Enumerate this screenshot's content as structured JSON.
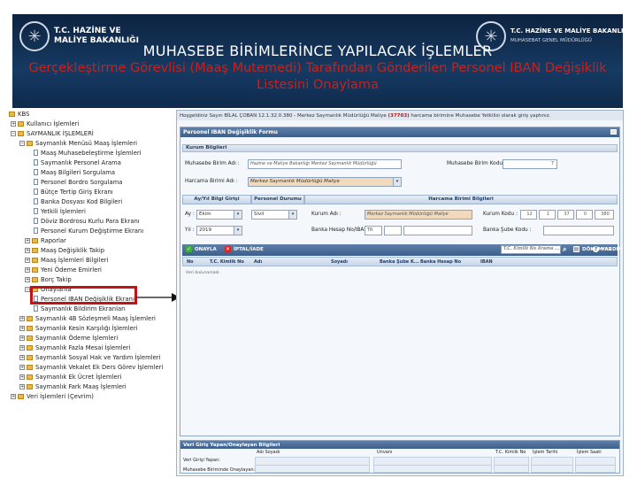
{
  "banner": {
    "logo_left_line1": "T.C. HAZİNE VE",
    "logo_left_line2": "MALİYE BAKANLIĞI",
    "logo_right_line1": "T.C. HAZİNE VE MALİYE BAKANLIĞI",
    "logo_right_line2": "MUHASEBAT GENEL MÜDÜRLÜĞÜ",
    "title": "MUHASEBE BİRİMLERİNCE YAPILACAK İŞLEMLER",
    "subtitle": "Gerçekleştirme Görevlisi (Maaş Mutemedi) Tarafından Gönderilen Personel IBAN Değişiklik Listesini Onaylama",
    "subtitle_color": "#c8211c"
  },
  "tree": {
    "root": "KBS",
    "items": [
      "Kullanıcı İşlemleri",
      "SAYMANLIK İŞLEMLERİ",
      "Saymanlık Menüsü Maaş İşlemleri",
      "Maaş Muhasebeleştirme İşlemleri",
      "Saymanlık Personel Arama",
      "Maaş Bilgileri Sorgulama",
      "Personel Bordro Sorgulama",
      "Bütçe Tertip Giriş Ekranı",
      "Banka Dosyası Kod Bilgileri",
      "Yetkili İşlemleri",
      "Döviz Bordrosu Kurlu Para Ekranı",
      "Personel Kurum Değiştirme Ekranı",
      "Raporlar",
      "Maaş Değişiklik Takip",
      "Maaş İşlemleri Bilgileri",
      "Yeni Ödeme Emirleri",
      "Borç Takip",
      "Onaylama",
      "Personel IBAN Değişiklik Ekranı",
      "Saymanlık Bildirim Ekranları",
      "Saymanlık 4B Sözleşmeli Maaş İşlemleri",
      "Saymanlık Kesin Karşılığı İşlemleri",
      "Saymanlık Ödeme İşlemleri",
      "Saymanlık Fazla Mesai İşlemleri",
      "Saymanlık Sosyal Hak ve Yardım İşlemleri",
      "Saymanlık Vekalet Ek Ders Görev İşlemleri",
      "Saymanlık Ek Ücret İşlemleri",
      "Saymanlık Fark Maaş İşlemleri",
      "Veri İşlemleri (Çevrim)"
    ]
  },
  "panel": {
    "welcome_prefix": "Hoşgeldiniz Sayın BİLAL ÇOBAN 12.1.32.0.380 - Merkez Saymanlık Müdürlüğü Maliye",
    "welcome_code": "(37703)",
    "welcome_suffix": "harcama birimine Muhasebe Yetkilisi olarak giriş yaptınız.",
    "form_title": "Personel IBAN Değişiklik Formu",
    "kurum_header": "Kurum Bilgileri",
    "muhasebe_label": "Muhasebe Birim Adı :",
    "muhasebe_value": "Hazine ve Maliye Bakanlığı Merkez Saymanlık Müdürlüğü",
    "muhasebe_kod_label": "Muhasebe Birim Kodu :",
    "muhasebe_kod_value": "7",
    "harcama_label": "Harcama Birimi Adı :",
    "harcama_value": "Merkez Saymanlık Müdürlüğü Maliye",
    "tab_ay_yil": "Ay/Yıl Bilgi Girişi",
    "tab_personel": "Personel Durumu",
    "tab_harcama": "Harcama Birimi Bilgileri",
    "ay_label": "Ay :",
    "ay_value": "Ekim",
    "yil_label": "Yıl :",
    "yil_value": "2019",
    "durum_value": "Sivil",
    "kurum_adi_label": "Kurum Adı :",
    "kurum_adi_value": "Merkez Saymanlık Müdürlüğü Maliye",
    "banka_label": "Banka Hesap No/IBAN :",
    "iban_prefix": "TR",
    "kurum_kodu_label": "Kurum Kodu :",
    "kurum_kodu_parts": [
      "12",
      "1",
      "37",
      "0",
      "380"
    ],
    "kurum_sube_label": "Banka Şube Kodu :",
    "btn_onayla": "ONAYLA",
    "btn_iptal": "İPTAL/İADE",
    "search_placeholder": "T.C. Kimlik No Arama ...",
    "btn_dokum": "DÖKÜM AL",
    "btn_yardim": "YARDIM",
    "columns": [
      "No",
      "T.C. Kimlik No",
      "Adı",
      "Soyadı",
      "Banka Şube K...",
      "Banka Hesap No",
      "IBAN"
    ],
    "empty_text": "Veri bulunamadı.",
    "bottom_header": "Veri Giriş Yapan/Onaylayan Bilgileri",
    "bottom_cols": [
      "Adı Soyadı",
      "Unvanı",
      "T.C. Kimlik No",
      "İşlem Tarihi",
      "İşlem Saati"
    ],
    "row_giris": "Veri Girişi Yapan:",
    "row_onay": "Muhasebe Biriminde Onaylayan:"
  },
  "highlight_color": "#c11414"
}
